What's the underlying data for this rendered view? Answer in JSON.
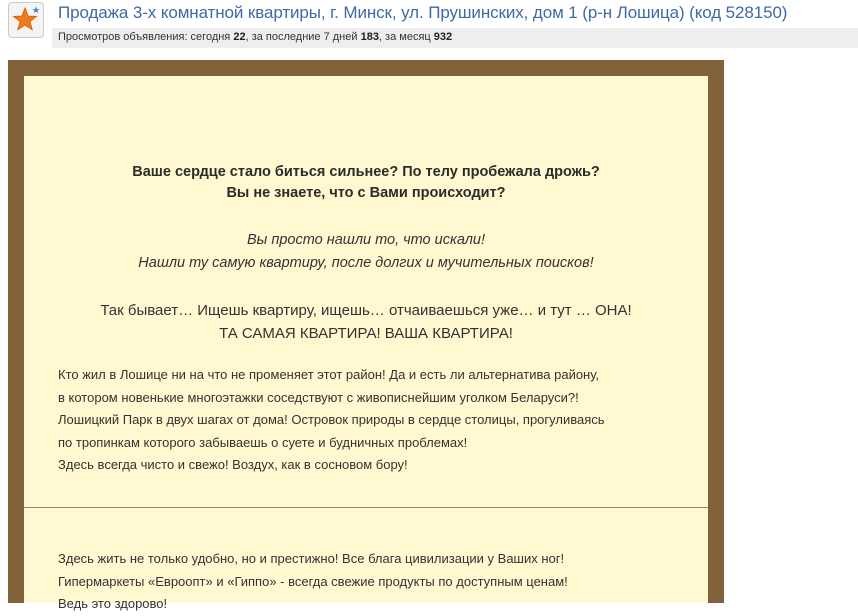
{
  "header": {
    "title": "Продажа 3-х комнатной квартиры, г. Минск, ул. Прушинских, дом 1 (р-н Лошица) (код 528150)",
    "stats": {
      "prefix": "Просмотров объявления: сегодня ",
      "today": "22",
      "mid1": ", за последние 7 дней ",
      "week": "183",
      "mid2": ", за месяц ",
      "month": "932"
    }
  },
  "ad": {
    "heading_lines": [
      "Ваше сердце стало биться сильнее? По телу пробежала дрожь?",
      "Вы не знаете, что с Вами происходит?"
    ],
    "italic_lines": [
      "Вы просто нашли то, что искали!",
      "Нашли ту самую квартиру, после долгих и мучительных поисков!"
    ],
    "big_lines": [
      "Так бывает… Ищешь квартиру, ищешь… отчаиваешься уже… и тут … ОНА!",
      "ТА САМАЯ КВАРТИРА! ВАША КВАРТИРА!"
    ],
    "para1_lines": [
      "Кто жил в Лошице ни на что не променяет этот район! Да и есть ли альтернатива району,",
      "в котором новенькие многоэтажки соседствуют с живописнейшим уголком Беларуси?!",
      "Лошицкий Парк в двух шагах от дома! Островок природы в сердце столицы, прогуливаясь",
      "по тропинкам которого забываешь о суете и будничных проблемах!",
      "Здесь всегда чисто и свежо! Воздух, как в сосновом бору!"
    ],
    "para2_lines": [
      "Здесь жить не только удобно, но и престижно! Все блага цивилизации у Ваших ног!",
      "Гипермаркеты «Евроопт» и «Гиппо» - всегда свежие продукты по доступным ценам!",
      "Ведь это здорово!"
    ]
  },
  "icons": {
    "favorite": "star-icon"
  },
  "colors": {
    "title": "#3e6aa6",
    "frame": "#80613a",
    "panel": "#fff8d0",
    "star": "#f07a1c"
  }
}
